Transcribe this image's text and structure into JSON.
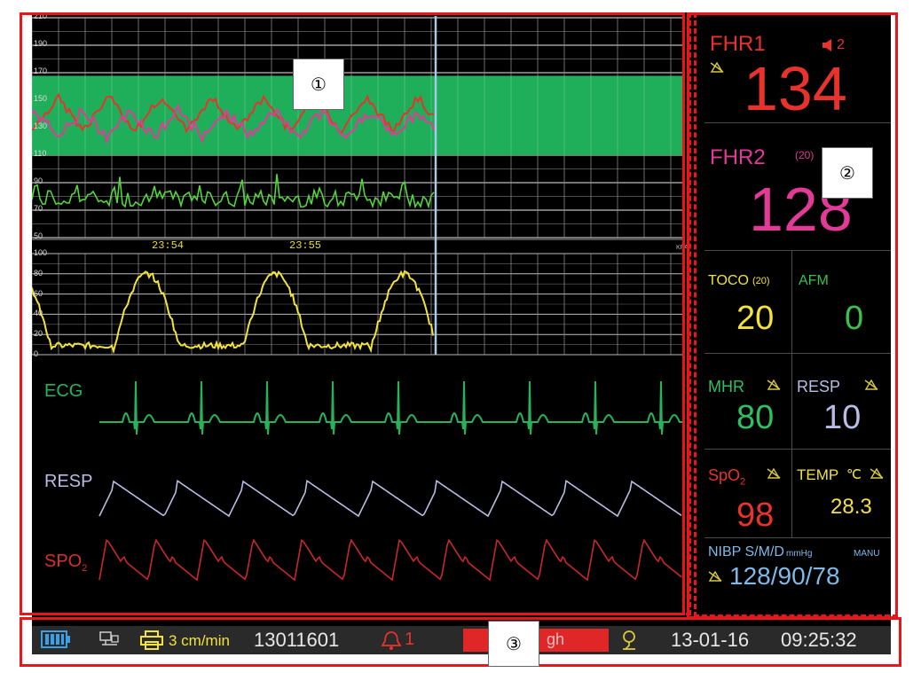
{
  "markers": {
    "one": "①",
    "two": "②",
    "three": "③"
  },
  "fhr_chart": {
    "y_ticks": [
      "210",
      "190",
      "170",
      "150",
      "130",
      "110",
      "90",
      "70",
      "50"
    ],
    "time_labels": [
      "23:54",
      "23:55"
    ],
    "normal_band": [
      110,
      160
    ]
  },
  "toco_chart": {
    "y_ticks": [
      "100",
      "80",
      "60",
      "40",
      "20",
      "0"
    ],
    "corner_label": "KPA"
  },
  "waves": {
    "ecg_label": "ECG",
    "resp_label": "RESP",
    "spo2_label": "SPO",
    "spo2_sub": "2"
  },
  "params": {
    "fhr1": {
      "label": "FHR1",
      "value": "134",
      "volume": "2"
    },
    "fhr2": {
      "label": "FHR2",
      "offset": "(20)",
      "value": "128"
    },
    "toco": {
      "label": "TOCO",
      "offset": "(20)",
      "value": "20"
    },
    "afm": {
      "label": "AFM",
      "value": "0"
    },
    "mhr": {
      "label": "MHR",
      "value": "80"
    },
    "resp": {
      "label": "RESP",
      "value": "10"
    },
    "spo2": {
      "label": "SpO",
      "sub": "2",
      "value": "98"
    },
    "temp": {
      "label": "TEMP",
      "unit": "℃",
      "value": "28.3"
    },
    "nibp": {
      "label": "NIBP S/M/D",
      "unit": "mmHg",
      "mode": "MANU",
      "value": "128/90/78"
    }
  },
  "status": {
    "speed": "3 cm/min",
    "id": "13011601",
    "alarm_count": "1",
    "alarm_text": "gh",
    "date": "13-01-16",
    "time": "09:25:32"
  },
  "colors": {
    "fhr1": "#e8332c",
    "fhr2": "#e23a97",
    "toco": "#f2e23a",
    "afm": "#3dc04a",
    "mhr": "#2fbf62",
    "resp": "#b8bde6",
    "temp": "#f2e23a",
    "nibp": "#7fb9e8",
    "band": "#1fae5a",
    "ecg": "#26b35a",
    "spo2_wave": "#c8282a",
    "annotation": "#e8161a"
  }
}
